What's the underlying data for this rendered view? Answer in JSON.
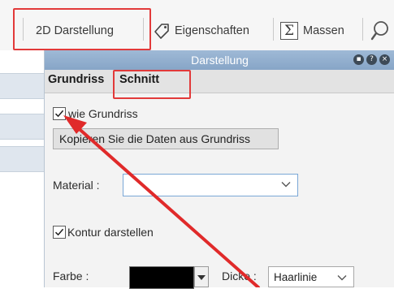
{
  "toolbar": {
    "darstellung_label": "2D Darstellung",
    "eigenschaften_label": "Eigenschaften",
    "massen_label": "Massen"
  },
  "panel": {
    "title": "Darstellung",
    "tabs": [
      "Grundriss",
      "Schnitt"
    ],
    "active_tab": "Schnitt",
    "wie_grundriss_label": "wie Grundriss",
    "wie_grundriss_checked": true,
    "copy_button_label": "Kopieren Sie die Daten aus Grundriss",
    "material_label": "Material :",
    "material_value": "",
    "kontur_label": "Kontur darstellen",
    "kontur_checked": true,
    "farbe_label": "Farbe :",
    "farbe_value": "#000000",
    "dicke_label": "Dicke :",
    "dicke_value": "Haarlinie"
  },
  "colors": {
    "highlight": "#e23a3a",
    "arrow": "#e02a2a",
    "titlebar": "#8fabcc"
  }
}
